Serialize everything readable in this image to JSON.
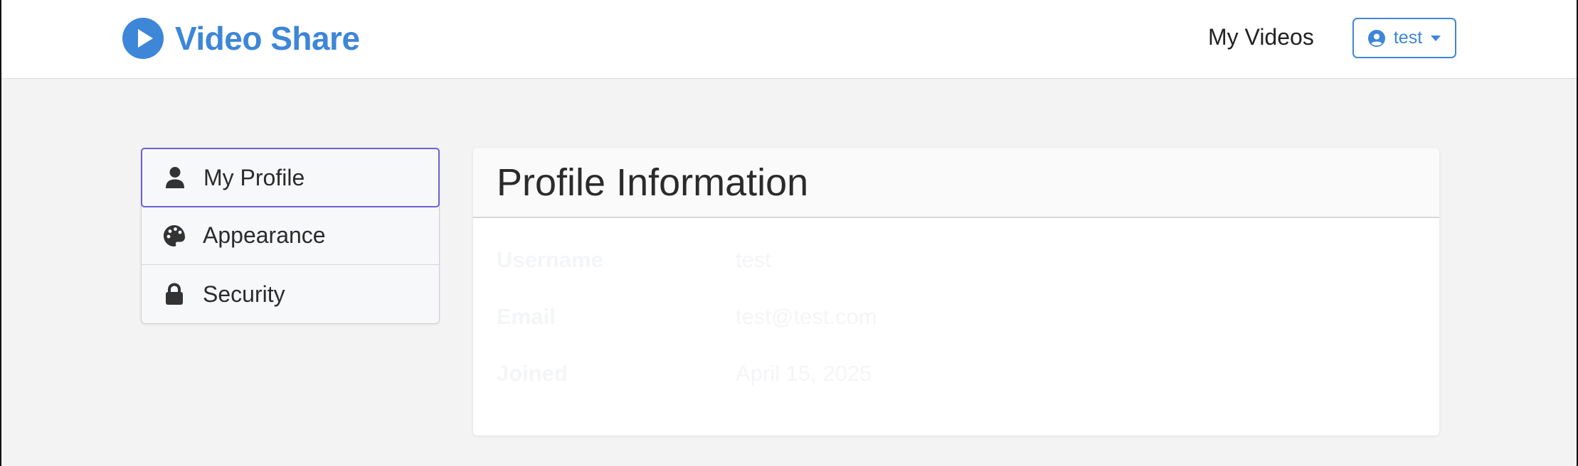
{
  "navbar": {
    "brand": "Video Share",
    "brand_icon": "play-circle-icon",
    "links": [
      {
        "label": "My Videos"
      }
    ],
    "user_menu": {
      "label": "test",
      "icon": "user-circle-icon"
    }
  },
  "sidebar": {
    "items": [
      {
        "label": "My Profile",
        "icon": "user-icon",
        "active": true
      },
      {
        "label": "Appearance",
        "icon": "palette-icon",
        "active": false
      },
      {
        "label": "Security",
        "icon": "lock-icon",
        "active": false
      }
    ]
  },
  "profile": {
    "title": "Profile Information",
    "fields": [
      {
        "label": "Username",
        "value": "test"
      },
      {
        "label": "Email",
        "value": "test@test.com"
      },
      {
        "label": "Joined",
        "value": "April 15, 2025"
      }
    ]
  },
  "colors": {
    "brand": "#3d86d8",
    "active_border": "#6b5fd9",
    "background": "#f3f3f3"
  }
}
